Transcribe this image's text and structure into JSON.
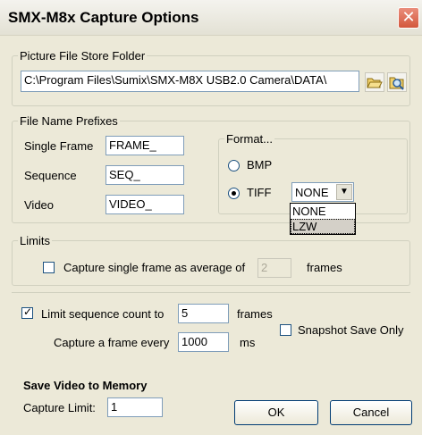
{
  "window": {
    "title": "SMX-M8x Capture Options",
    "close_glyph": "✕"
  },
  "store_folder": {
    "label": "Picture File Store Folder",
    "path": "C:\\Program Files\\Sumix\\SMX-M8X USB2.0 Camera\\DATA\\",
    "browse_icon": "folder-open-icon",
    "search_icon": "magnifier-folder-icon"
  },
  "prefixes": {
    "label": "File Name Prefixes",
    "single_frame": {
      "label": "Single Frame",
      "value": "FRAME_"
    },
    "sequence": {
      "label": "Sequence",
      "value": "SEQ_"
    },
    "video": {
      "label": "Video",
      "value": "VIDEO_"
    }
  },
  "format": {
    "label": "Format...",
    "options": [
      {
        "label": "BMP",
        "selected": false
      },
      {
        "label": "TIFF",
        "selected": true
      }
    ],
    "compression": {
      "selected": "NONE",
      "options": [
        "NONE",
        "LZW"
      ],
      "highlighted": "LZW"
    }
  },
  "limits": {
    "label": "Limits",
    "average": {
      "label_before": "Capture single frame as average of",
      "value": "2",
      "label_after": "frames",
      "checked": false
    },
    "sequence_count": {
      "label": "Limit sequence count to",
      "value": "5",
      "unit": "frames",
      "checked": true
    },
    "frame_every": {
      "label": "Capture a frame every",
      "value": "1000",
      "unit": "ms"
    },
    "snapshot_only": {
      "label": "Snapshot Save Only",
      "checked": false
    }
  },
  "memory": {
    "title": "Save Video to Memory",
    "capture_limit_label": "Capture Limit:",
    "capture_limit_value": "1"
  },
  "buttons": {
    "ok": "OK",
    "cancel": "Cancel"
  },
  "colors": {
    "window_bg": "#ece9d8",
    "close_red": "#d3573c",
    "field_border": "#7f9db9"
  }
}
